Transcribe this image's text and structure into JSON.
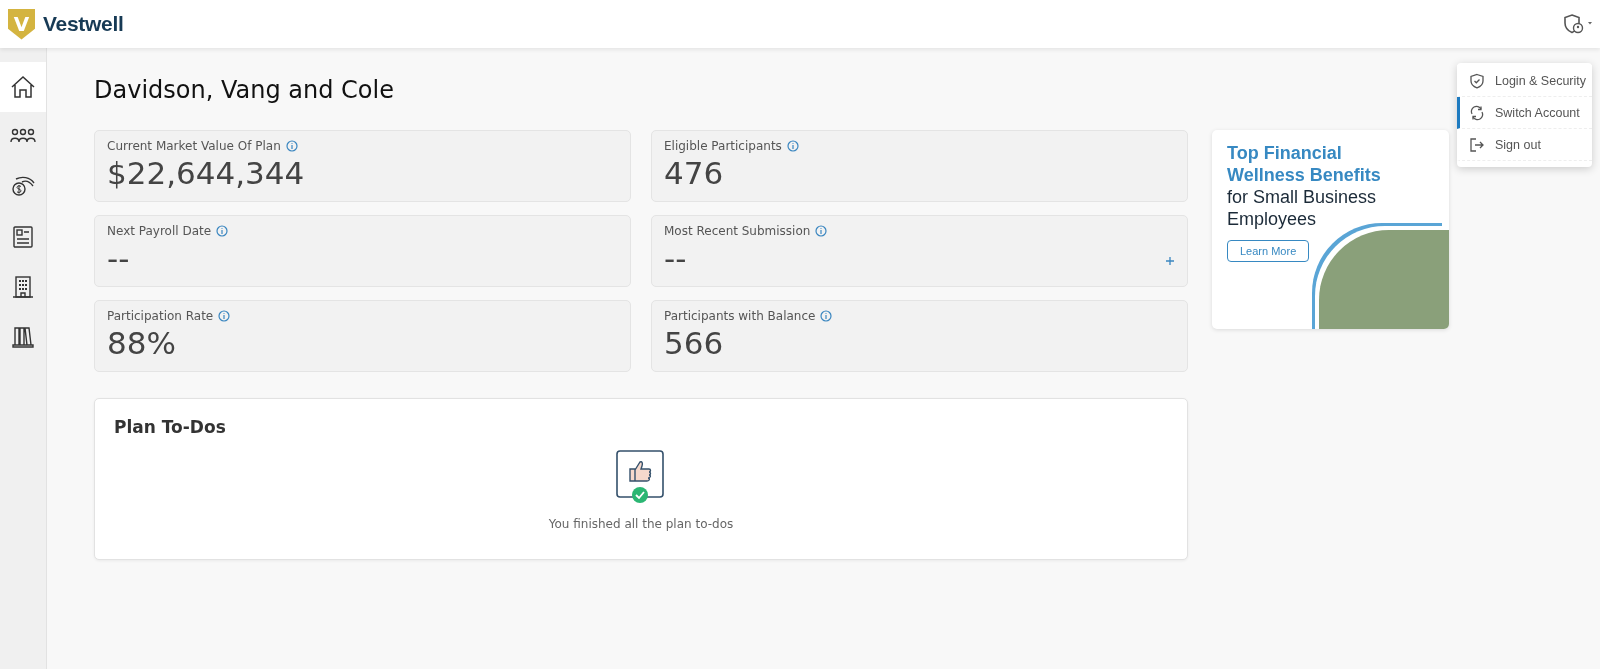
{
  "header": {
    "logo_letter": "V",
    "brand": "Vestwell"
  },
  "sidebar": {
    "items": [
      {
        "kind": "home",
        "selected": true
      },
      {
        "kind": "people",
        "selected": false
      },
      {
        "kind": "money",
        "selected": false
      },
      {
        "kind": "document",
        "selected": false
      },
      {
        "kind": "building",
        "selected": false
      },
      {
        "kind": "library",
        "selected": false
      }
    ]
  },
  "page_title": "Davidson, Vang and Cole",
  "stats": [
    {
      "label": "Current Market Value Of Plan",
      "value": "$22,644,344",
      "add": false
    },
    {
      "label": "Eligible Participants",
      "value": "476",
      "add": false
    },
    {
      "label": "Next Payroll Date",
      "value": "--",
      "add": false
    },
    {
      "label": "Most Recent Submission",
      "value": "--",
      "add": true
    },
    {
      "label": "Participation Rate",
      "value": "88%",
      "add": false
    },
    {
      "label": "Participants with Balance",
      "value": "566",
      "add": false
    }
  ],
  "todos": {
    "title": "Plan To-Dos",
    "message": "You finished all the plan to-dos"
  },
  "promo": {
    "headline": "Top Financial Wellness Benefits",
    "subline": "for Small Business Employees",
    "button": "Learn More"
  },
  "account_menu": {
    "items": [
      {
        "label": "Login & Security",
        "kind": "shield",
        "selected": false
      },
      {
        "label": "Switch Account",
        "kind": "sync",
        "selected": true
      },
      {
        "label": "Sign out",
        "kind": "exit",
        "selected": false
      }
    ]
  }
}
